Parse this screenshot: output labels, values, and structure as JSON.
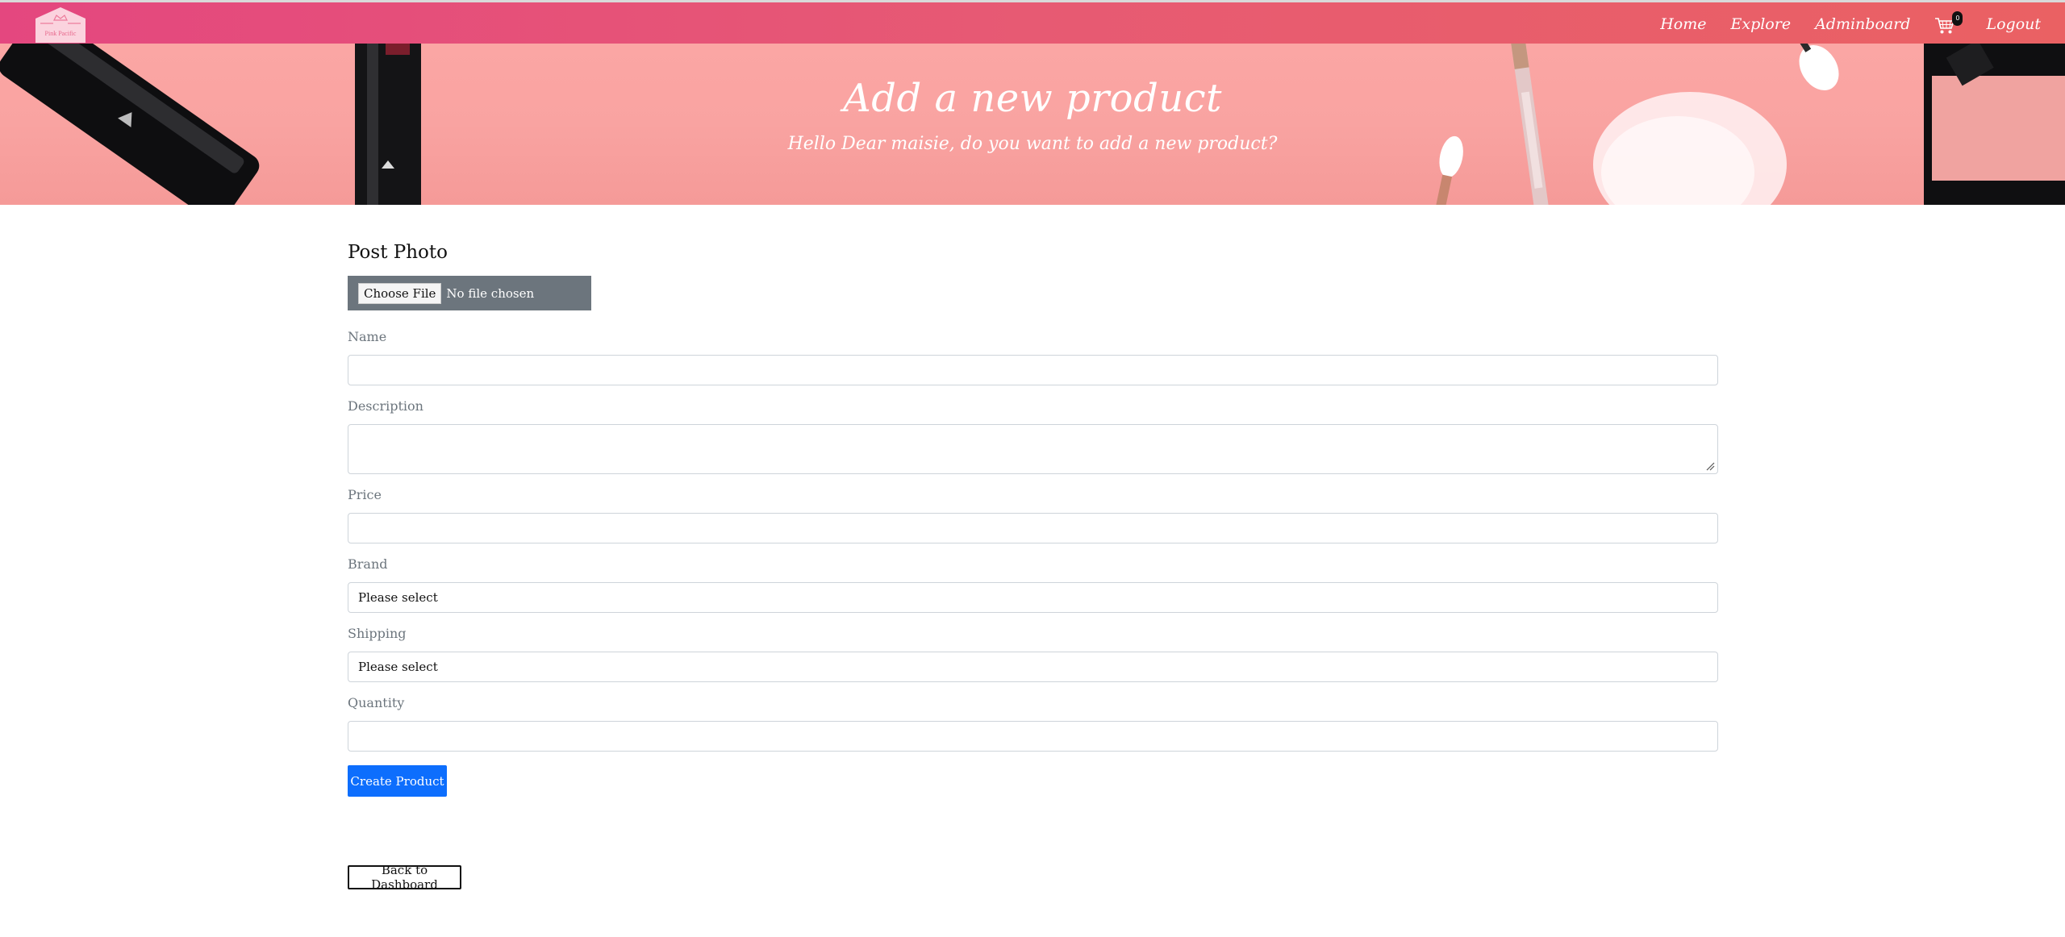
{
  "brand": {
    "name": "Pink Pacific",
    "logo_icon": "crown-icon"
  },
  "nav": {
    "home": "Home",
    "explore": "Explore",
    "adminboard": "Adminboard",
    "cart_icon": "cart-icon",
    "cart_count": "0",
    "logout": "Logout"
  },
  "hero": {
    "title": "Add a new product",
    "subtitle": "Hello Dear maisie, do you want to add a new product?"
  },
  "form": {
    "photo_heading": "Post Photo",
    "file_button": "Choose File",
    "file_status": "No file chosen",
    "name_label": "Name",
    "name_value": "",
    "description_label": "Description",
    "description_value": "",
    "price_label": "Price",
    "price_value": "",
    "brand_label": "Brand",
    "brand_selected": "Please select",
    "shipping_label": "Shipping",
    "shipping_selected": "Please select",
    "quantity_label": "Quantity",
    "quantity_value": "",
    "create_button": "Create Product",
    "back_button": "Back to Dashboard"
  },
  "colors": {
    "navbar_start": "#e4477f",
    "navbar_end": "#ea6163",
    "hero_bg": "#f9a3a1",
    "primary": "#0d6efd",
    "file_box": "#6c757d"
  }
}
